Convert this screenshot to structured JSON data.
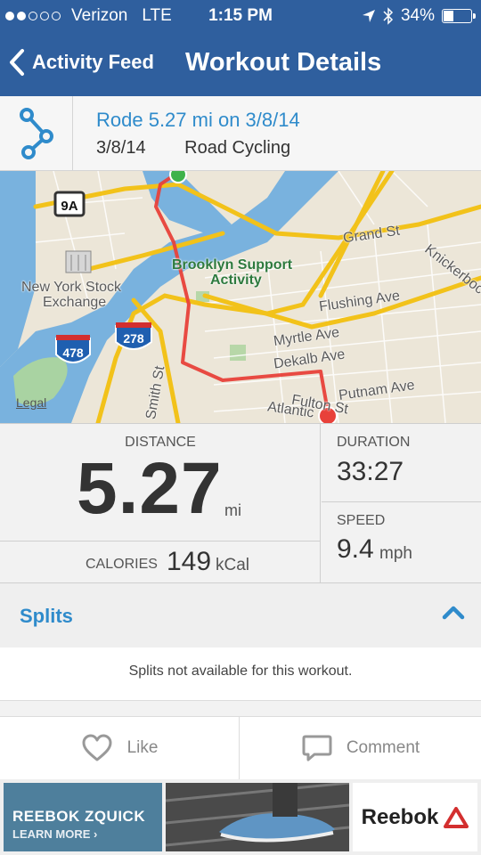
{
  "status_bar": {
    "carrier": "Verizon",
    "network": "LTE",
    "time": "1:15 PM",
    "battery": "34%",
    "battery_level": 0.34,
    "signal_bars_filled": 2,
    "signal_bars_total": 5
  },
  "nav": {
    "back_label": "Activity Feed",
    "title": "Workout Details"
  },
  "workout": {
    "title": "Rode 5.27 mi on 3/8/14",
    "date": "3/8/14",
    "type": "Road Cycling",
    "icon": "route-icon"
  },
  "map": {
    "labels": {
      "new_york_stock": "New York Stock",
      "exchange": "Exchange",
      "brooklyn_support": "Brooklyn Support",
      "activity": "Activity",
      "grand_st": "Grand St",
      "knickerbocker": "Knickerboc",
      "flushing_ave": "Flushing Ave",
      "myrtle_ave": "Myrtle Ave",
      "dekalb_ave": "Dekalb Ave",
      "putnam_ave": "Putnam Ave",
      "atlantic": "Atlantic",
      "fulton_st": "Fulton St",
      "smith_st": "Smith St"
    },
    "shields": {
      "route_9a": "9A",
      "i478": "478",
      "i278": "278"
    },
    "legal": "Legal",
    "colors": {
      "route": "#e8413a",
      "start": "#3fb24a",
      "end": "#e8413a",
      "water": "#6aa9d9",
      "highway": "#f2c21a"
    }
  },
  "stats": {
    "distance": {
      "label": "DISTANCE",
      "value": "5.27",
      "unit": "mi"
    },
    "calories": {
      "label": "CALORIES",
      "value": "149",
      "unit": "kCal"
    },
    "duration": {
      "label": "DURATION",
      "value": "33:27"
    },
    "speed": {
      "label": "SPEED",
      "value": "9.4",
      "unit": "mph"
    }
  },
  "splits": {
    "label": "Splits",
    "message": "Splits not available for this workout."
  },
  "actions": {
    "like": "Like",
    "comment": "Comment"
  },
  "ad": {
    "headline": "REEBOK ZQUICK",
    "cta": "LEARN MORE ›",
    "brand": "Reebok"
  },
  "theme": {
    "nav_blue": "#2f5f9e",
    "accent_blue": "#2f8bcb"
  }
}
